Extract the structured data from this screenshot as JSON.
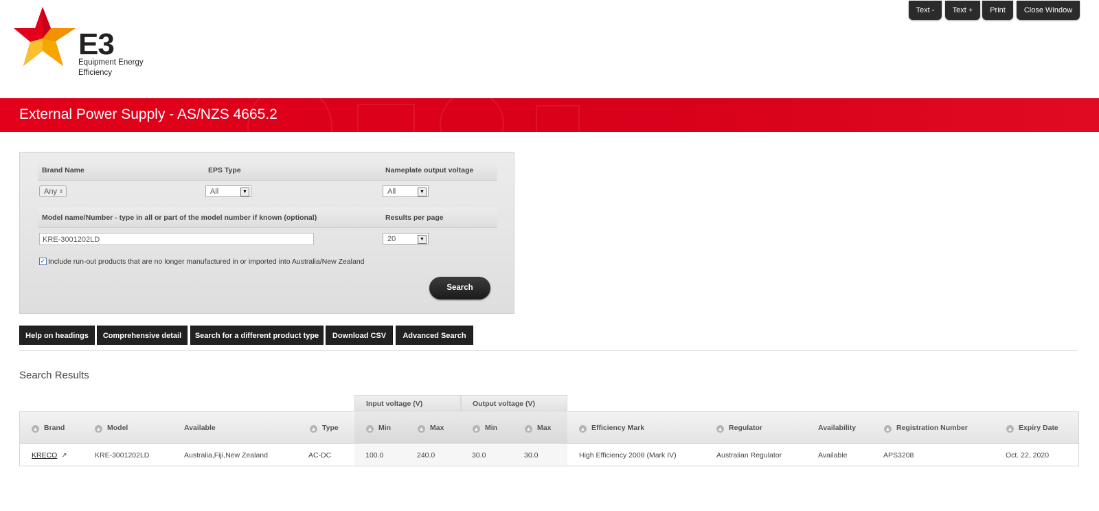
{
  "toolbar": {
    "text_minus": "Text -",
    "text_plus": "Text +",
    "print": "Print",
    "close_window": "Close Window"
  },
  "logo": {
    "mark": "E3",
    "line1": "Equipment Energy",
    "line2": "Efficiency"
  },
  "banner": {
    "title": "External Power Supply - AS/NZS 4665.2"
  },
  "search_form": {
    "brand_label": "Brand Name",
    "brand_value": "Any",
    "eps_type_label": "EPS Type",
    "eps_type_value": "All",
    "voltage_label": "Nameplate output voltage",
    "voltage_value": "All",
    "model_label": "Model name/Number - type in all or part of the model number if known (optional)",
    "model_value": "KRE-3001202LD",
    "results_per_page_label": "Results per page",
    "results_per_page_value": "20",
    "runout_checked": true,
    "runout_label": "Include run-out products that are no longer manufactured in or imported into Australia/New Zealand",
    "search_button": "Search"
  },
  "actions": {
    "help": "Help on headings",
    "comprehensive": "Comprehensive detail",
    "different_type": "Search for a different product type",
    "download_csv": "Download CSV",
    "advanced": "Advanced Search"
  },
  "results": {
    "title": "Search Results",
    "group_input": "Input voltage (V)",
    "group_output": "Output voltage (V)",
    "columns": {
      "brand": "Brand",
      "model": "Model",
      "available": "Available",
      "type": "Type",
      "in_min": "Min",
      "in_max": "Max",
      "out_min": "Min",
      "out_max": "Max",
      "efficiency": "Efficiency Mark",
      "regulator": "Regulator",
      "availability": "Availability",
      "registration": "Registration Number",
      "expiry": "Expiry Date"
    },
    "rows": [
      {
        "brand": "KRECO",
        "model": "KRE-3001202LD",
        "available": "Australia,Fiji,New Zealand",
        "type": "AC-DC",
        "in_min": "100.0",
        "in_max": "240.0",
        "out_min": "30.0",
        "out_max": "30.0",
        "efficiency": "High Efficiency 2008 (Mark IV)",
        "regulator": "Australian Regulator",
        "availability": "Available",
        "registration": "APS3208",
        "expiry": "Oct. 22, 2020"
      }
    ]
  },
  "colors": {
    "banner_red": "#e2001a",
    "button_dark": "#222222"
  }
}
